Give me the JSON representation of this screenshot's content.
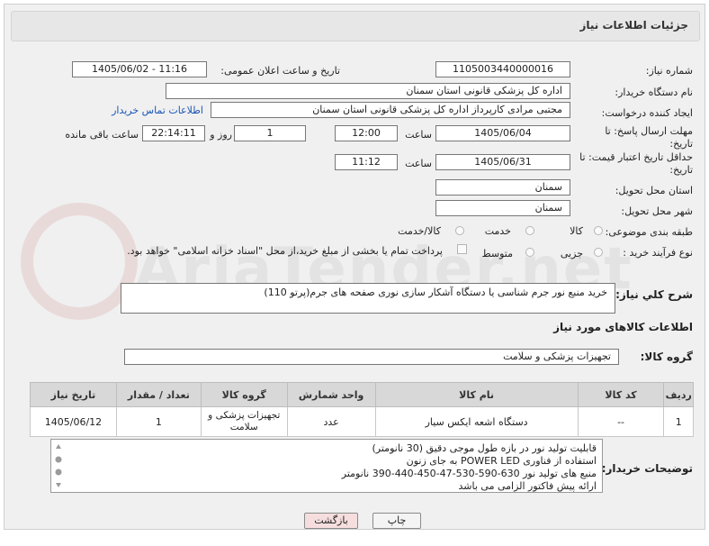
{
  "header": {
    "title": "جزئیات اطلاعات نیاز"
  },
  "fields": {
    "need_number_label": "شماره نیاز:",
    "need_number": "1105003440000016",
    "announce_label": "تاریخ و ساعت اعلان عمومی:",
    "announce_value": "1405/06/02 - 11:16",
    "buyer_org_label": "نام دستگاه خریدار:",
    "buyer_org": "اداره کل پزشکی قانونی استان سمنان",
    "creator_label": "ایجاد کننده درخواست:",
    "creator": "مجتبی مرادی کارپرداز اداره کل پزشکی قانونی استان سمنان",
    "contact_link": "اطلاعات تماس خریدار",
    "deadline_label": "مهلت ارسال پاسخ: تا تاریخ:",
    "deadline_date": "1405/06/04",
    "time_label": "ساعت",
    "deadline_time": "12:00",
    "days_value": "1",
    "days_label": "روز و",
    "remaining_time": "22:14:11",
    "remaining_label": "ساعت باقی مانده",
    "validity_label": "حداقل تاریخ اعتبار قیمت: تا تاریخ:",
    "validity_date": "1405/06/31",
    "validity_time": "11:12",
    "province_label": "استان محل تحویل:",
    "province": "سمنان",
    "city_label": "شهر محل تحویل:",
    "city": "سمنان",
    "category_label": "طبقه بندی موضوعی:",
    "category_options": [
      "کالا",
      "خدمت",
      "کالا/خدمت"
    ],
    "process_label": "نوع فرآیند خرید :",
    "process_options": [
      "جزیی",
      "متوسط"
    ],
    "payment_note": "پرداخت تمام یا بخشی از مبلغ خرید،از محل \"اسناد خزانه اسلامی\" خواهد بود."
  },
  "summary": {
    "label": "شرح کلي نياز:",
    "text": "خرید منبع نور جرم شناسی یا دستگاه آشکار سازی نوری صفحه های جرم(پرتو 110)"
  },
  "goods_section": {
    "title": "اطلاعات کالاهای مورد نیاز",
    "group_label": "گروه کالا:",
    "group_value": "تجهیزات پزشکی و سلامت"
  },
  "table": {
    "headers": [
      "ردیف",
      "کد کالا",
      "نام کالا",
      "واحد شمارش",
      "گروه کالا",
      "تعداد / مقدار",
      "تاریخ نیاز"
    ],
    "rows": [
      [
        "1",
        "--",
        "دستگاه اشعه ایکس سیار",
        "عدد",
        "تجهیزات پزشکی و سلامت",
        "1",
        "1405/06/12"
      ]
    ]
  },
  "buyer_notes": {
    "label": "توضیحات خریدار:",
    "lines": [
      "قابلیت تولید نور در بازه طول موجی دقیق (30 نانومتر)",
      "استفاده از فناوری POWER LED به جای زنون",
      "منبع های تولید نور 630-590-530-47-450-440-390 نانومتر",
      "ارائه پیش فاکتور الزامی می باشد"
    ]
  },
  "buttons": {
    "print": "چاپ",
    "back": "بازگشت"
  },
  "colors": {
    "link": "#1a56b8",
    "back_button": "#f7dede",
    "header_bg": "#e7e7e7"
  }
}
